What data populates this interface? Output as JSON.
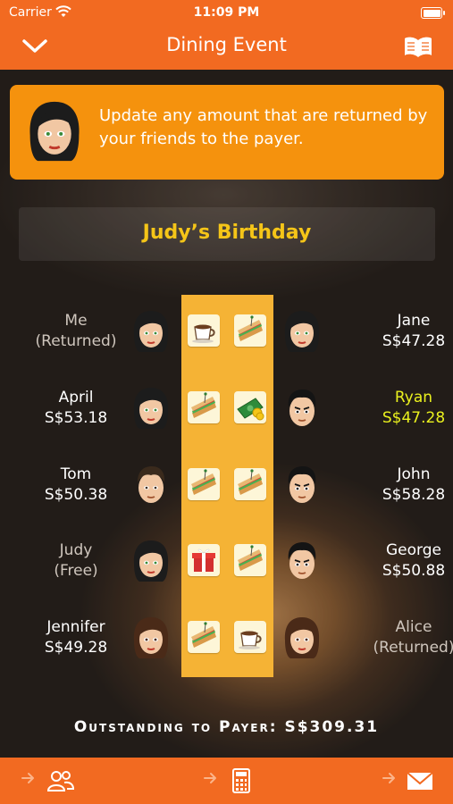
{
  "status_bar": {
    "carrier": "Carrier",
    "time": "11:09 PM"
  },
  "nav": {
    "title": "Dining Event",
    "back_icon": "chevron-down-icon",
    "guide_icon": "open-book-icon"
  },
  "banner": {
    "text": "Update any amount that are returned by your friends to the payer."
  },
  "event": {
    "title": "Judy’s Birthday"
  },
  "left_people": [
    {
      "name": "Me",
      "detail": "(Returned)",
      "style": "muted",
      "avatar": "female-avatar",
      "item": "coffee-cup-icon"
    },
    {
      "name": "April",
      "detail": "S$53.18",
      "style": "normal",
      "avatar": "female-avatar",
      "item": "sandwich-icon"
    },
    {
      "name": "Tom",
      "detail": "S$50.38",
      "style": "normal",
      "avatar": "male-avatar",
      "item": "sandwich-icon"
    },
    {
      "name": "Judy",
      "detail": "(Free)",
      "style": "muted",
      "avatar": "female-avatar",
      "item": "gift-icon"
    },
    {
      "name": "Jennifer",
      "detail": "S$49.28",
      "style": "normal",
      "avatar": "female-brown-avatar",
      "item": "sandwich-icon"
    }
  ],
  "right_people": [
    {
      "name": "Jane",
      "detail": "S$47.28",
      "style": "normal",
      "avatar": "female-avatar",
      "item": "sandwich-icon"
    },
    {
      "name": "Ryan",
      "detail": "S$47.28",
      "style": "highlight",
      "avatar": "male-dark-avatar",
      "item": "money-icon"
    },
    {
      "name": "John",
      "detail": "S$58.28",
      "style": "normal",
      "avatar": "male-dark-avatar",
      "item": "sandwich-icon"
    },
    {
      "name": "George",
      "detail": "S$50.88",
      "style": "normal",
      "avatar": "male-dark-avatar",
      "item": "sandwich-icon"
    },
    {
      "name": "Alice",
      "detail": "(Returned)",
      "style": "muted",
      "avatar": "female-brown-avatar",
      "item": "coffee-cup-icon"
    }
  ],
  "outstanding": {
    "text": "Outstanding to Payer: S$309.31"
  },
  "bottom_bar": {
    "icons": [
      "group-icon",
      "calculator-icon",
      "envelope-icon"
    ]
  },
  "colors": {
    "accent": "#f26a21",
    "banner": "#f5920d",
    "column": "#f5b335",
    "title": "#f5c518",
    "highlight": "#eaf11e"
  }
}
